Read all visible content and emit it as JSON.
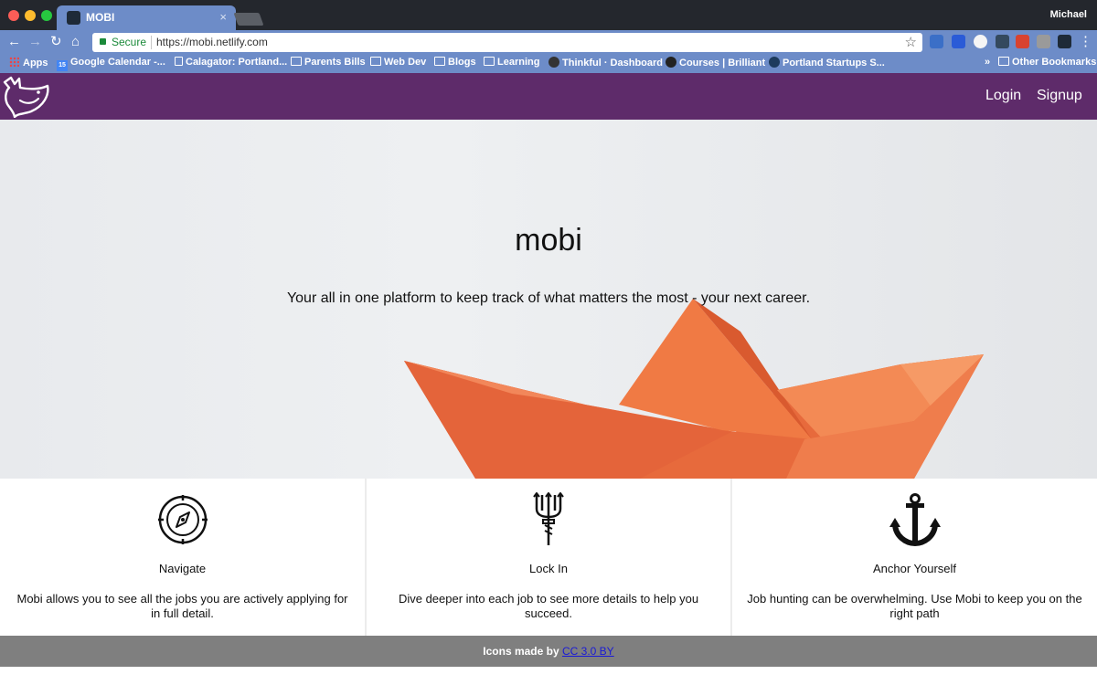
{
  "browser": {
    "tab_title": "MOBI",
    "profile_name": "Michael",
    "secure_label": "Secure",
    "url": "https://mobi.netlify.com",
    "bookmarks": [
      {
        "label": "Apps",
        "icon": "apps-icon"
      },
      {
        "label": "Google Calendar -...",
        "icon": "calendar-icon"
      },
      {
        "label": "Calagator: Portland...",
        "icon": "page-icon"
      },
      {
        "label": "Parents Bills",
        "icon": "folder-icon"
      },
      {
        "label": "Web Dev",
        "icon": "folder-icon"
      },
      {
        "label": "Blogs",
        "icon": "folder-icon"
      },
      {
        "label": "Learning",
        "icon": "folder-icon"
      },
      {
        "label": "Thinkful · Dashboard",
        "icon": "thinkful-icon"
      },
      {
        "label": "Courses | Brilliant",
        "icon": "brilliant-icon"
      },
      {
        "label": "Portland Startups S...",
        "icon": "startups-icon"
      }
    ],
    "overflow_label": "»",
    "other_bookmarks": "Other Bookmarks"
  },
  "header": {
    "login_label": "Login",
    "signup_label": "Signup",
    "bg_color": "#5e2b6a"
  },
  "hero": {
    "title": "mobi",
    "subtitle": "Your all in one platform to keep track of what matters the most - your next career."
  },
  "features": [
    {
      "icon": "compass-icon",
      "title": "Navigate",
      "text": "Mobi allows you to see all the jobs you are actively applying for in full detail."
    },
    {
      "icon": "trident-icon",
      "title": "Lock In",
      "text": "Dive deeper into each job to see more details to help you succeed."
    },
    {
      "icon": "anchor-icon",
      "title": "Anchor Yourself",
      "text": "Job hunting can be overwhelming. Use Mobi to keep you on the right path"
    }
  ],
  "footer": {
    "text": "Icons made by",
    "link_label": "CC 3.0 BY"
  }
}
